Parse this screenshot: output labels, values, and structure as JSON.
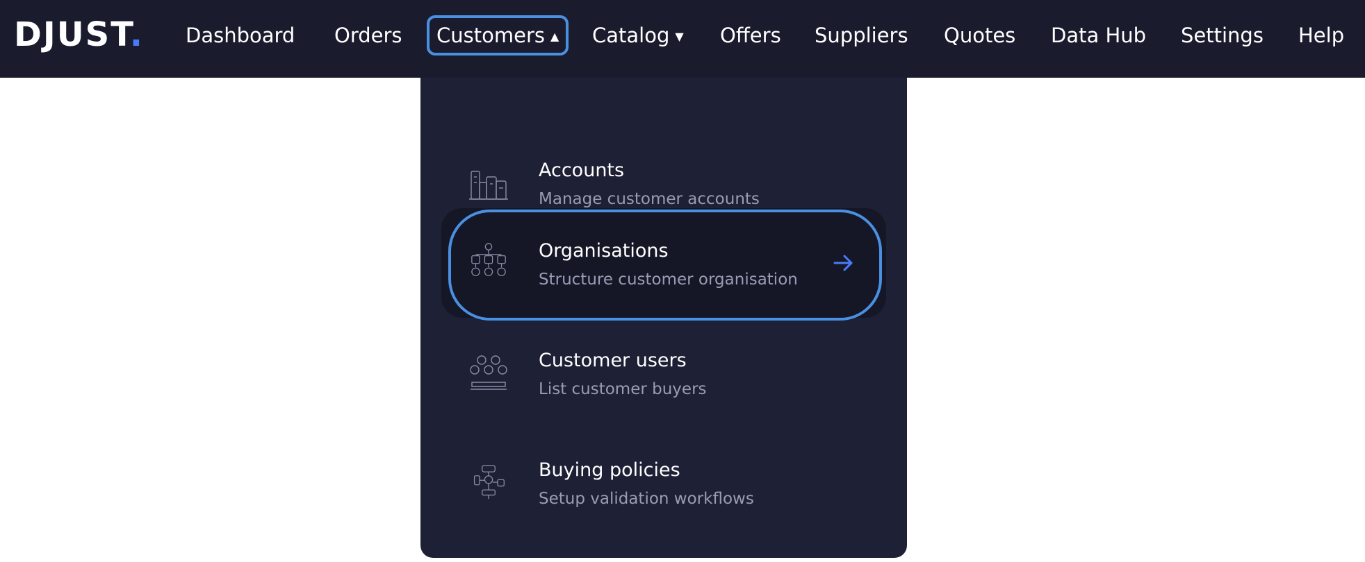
{
  "brand": {
    "name": "DJUST",
    "dot": ".",
    "accent": "#4a7bf7"
  },
  "nav": {
    "items": [
      {
        "label": "Dashboard"
      },
      {
        "label": "Orders"
      },
      {
        "label": "Customers",
        "caret": "▲",
        "active": true
      },
      {
        "label": "Catalog",
        "caret": "▼"
      },
      {
        "label": "Offers"
      },
      {
        "label": "Suppliers"
      },
      {
        "label": "Quotes"
      },
      {
        "label": "Data Hub"
      },
      {
        "label": "Settings"
      },
      {
        "label": "Help"
      }
    ]
  },
  "customers_menu": {
    "items": [
      {
        "title": "Accounts",
        "description": "Manage customer accounts",
        "icon": "buildings-icon"
      },
      {
        "title": "Organisations",
        "description": "Structure customer organisation",
        "icon": "org-chart-icon",
        "highlighted": true,
        "arrow_icon": "arrow-right-icon"
      },
      {
        "title": "Customer users",
        "description": "List customer buyers",
        "icon": "users-group-icon"
      },
      {
        "title": "Buying policies",
        "description": "Setup validation workflows",
        "icon": "workflow-icon"
      }
    ]
  },
  "colors": {
    "topbar_bg": "#1a1c2e",
    "menu_bg": "#1e2036",
    "highlight_border": "#4a90e2",
    "arrow": "#4a7bf7"
  }
}
